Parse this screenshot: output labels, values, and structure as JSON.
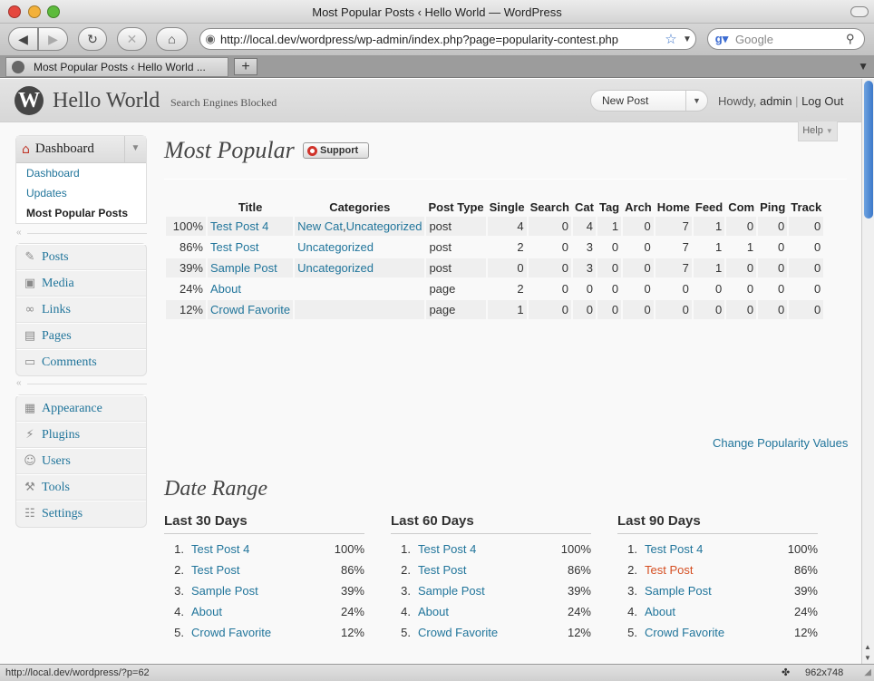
{
  "browser": {
    "window_title": "Most Popular Posts ‹ Hello World — WordPress",
    "url": "http://local.dev/wordpress/wp-admin/index.php?page=popularity-contest.php",
    "search_placeholder": "Google",
    "tab_title": "Most Popular Posts ‹ Hello World ...",
    "new_tab": "+",
    "status_text": "http://local.dev/wordpress/?p=62",
    "window_size": "962x748"
  },
  "header": {
    "logo": "W",
    "site_title": "Hello World",
    "visibility_note": "Search Engines Blocked",
    "favorite_action": "New Post",
    "howdy_prefix": "Howdy,",
    "username": "admin",
    "separator": "|",
    "logout": "Log Out",
    "help": "Help"
  },
  "sidebar": {
    "dashboard": {
      "label": "Dashboard",
      "items": [
        "Dashboard",
        "Updates",
        "Most Popular Posts"
      ]
    },
    "group1": [
      {
        "label": "Posts",
        "icon": "pin-icon"
      },
      {
        "label": "Media",
        "icon": "media-icon"
      },
      {
        "label": "Links",
        "icon": "link-icon"
      },
      {
        "label": "Pages",
        "icon": "pages-icon"
      },
      {
        "label": "Comments",
        "icon": "comment-icon"
      }
    ],
    "group2": [
      {
        "label": "Appearance",
        "icon": "appearance-icon"
      },
      {
        "label": "Plugins",
        "icon": "plugin-icon"
      },
      {
        "label": "Users",
        "icon": "users-icon"
      },
      {
        "label": "Tools",
        "icon": "tools-icon"
      },
      {
        "label": "Settings",
        "icon": "settings-icon"
      }
    ]
  },
  "main": {
    "title": "Most Popular",
    "support_label": "Support",
    "columns": [
      "",
      "Title",
      "Categories",
      "Post Type",
      "Single",
      "Search",
      "Cat",
      "Tag",
      "Arch",
      "Home",
      "Feed",
      "Com",
      "Ping",
      "Track"
    ],
    "rows": [
      {
        "pct": "100%",
        "title": "Test Post 4",
        "categories": [
          "New Cat",
          "Uncategorized"
        ],
        "type": "post",
        "values": [
          "4",
          "0",
          "4",
          "1",
          "0",
          "7",
          "1",
          "0",
          "0",
          "0"
        ]
      },
      {
        "pct": "86%",
        "title": "Test Post",
        "categories": [
          "Uncategorized"
        ],
        "type": "post",
        "values": [
          "2",
          "0",
          "3",
          "0",
          "0",
          "7",
          "1",
          "1",
          "0",
          "0"
        ]
      },
      {
        "pct": "39%",
        "title": "Sample Post",
        "categories": [
          "Uncategorized"
        ],
        "type": "post",
        "values": [
          "0",
          "0",
          "3",
          "0",
          "0",
          "7",
          "1",
          "0",
          "0",
          "0"
        ]
      },
      {
        "pct": "24%",
        "title": "About",
        "categories": [],
        "type": "page",
        "values": [
          "2",
          "0",
          "0",
          "0",
          "0",
          "0",
          "0",
          "0",
          "0",
          "0"
        ]
      },
      {
        "pct": "12%",
        "title": "Crowd Favorite",
        "categories": [],
        "type": "page",
        "values": [
          "1",
          "0",
          "0",
          "0",
          "0",
          "0",
          "0",
          "0",
          "0",
          "0"
        ]
      }
    ],
    "change_link": "Change Popularity Values",
    "date_range_title": "Date Range",
    "ranges": [
      {
        "heading": "Last 30 Days",
        "items": [
          {
            "n": "1.",
            "title": "Test Post 4",
            "pct": "100%"
          },
          {
            "n": "2.",
            "title": "Test Post",
            "pct": "86%"
          },
          {
            "n": "3.",
            "title": "Sample Post",
            "pct": "39%"
          },
          {
            "n": "4.",
            "title": "About",
            "pct": "24%"
          },
          {
            "n": "5.",
            "title": "Crowd Favorite",
            "pct": "12%"
          }
        ]
      },
      {
        "heading": "Last 60 Days",
        "items": [
          {
            "n": "1.",
            "title": "Test Post 4",
            "pct": "100%"
          },
          {
            "n": "2.",
            "title": "Test Post",
            "pct": "86%"
          },
          {
            "n": "3.",
            "title": "Sample Post",
            "pct": "39%"
          },
          {
            "n": "4.",
            "title": "About",
            "pct": "24%"
          },
          {
            "n": "5.",
            "title": "Crowd Favorite",
            "pct": "12%"
          }
        ]
      },
      {
        "heading": "Last 90 Days",
        "items": [
          {
            "n": "1.",
            "title": "Test Post 4",
            "pct": "100%"
          },
          {
            "n": "2.",
            "title": "Test Post",
            "pct": "86%",
            "hover": true
          },
          {
            "n": "3.",
            "title": "Sample Post",
            "pct": "39%"
          },
          {
            "n": "4.",
            "title": "About",
            "pct": "24%"
          },
          {
            "n": "5.",
            "title": "Crowd Favorite",
            "pct": "12%"
          }
        ]
      }
    ]
  },
  "colors": {
    "link": "#21759b",
    "link_hover": "#d54e21"
  }
}
